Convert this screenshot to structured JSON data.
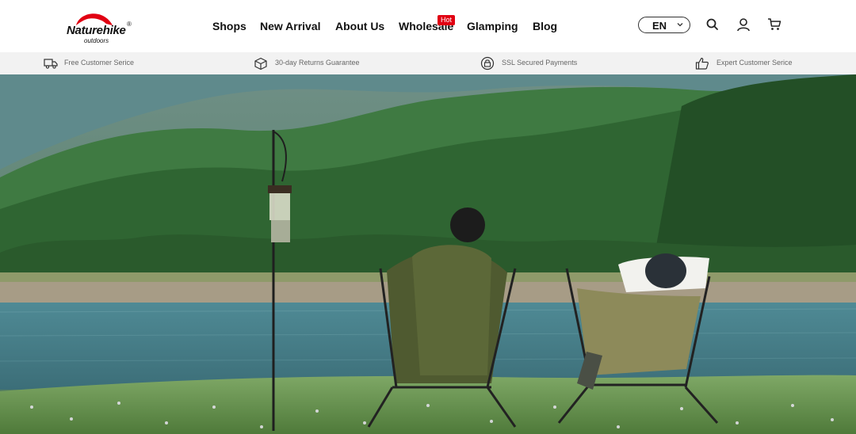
{
  "logo": {
    "main": "Naturehike",
    "sub": "outdoors",
    "reg": "®"
  },
  "nav": {
    "items": [
      "Shops",
      "New Arrival",
      "About Us",
      "Wholesale",
      "Glamping",
      "Blog"
    ],
    "hot_badge": "Hot"
  },
  "header": {
    "lang": "EN",
    "icons": [
      "search-icon",
      "account-icon",
      "cart-icon"
    ]
  },
  "trust": [
    {
      "icon": "truck-icon",
      "text": "Free Customer Serice"
    },
    {
      "icon": "box-icon",
      "text": "30-day Returns Guarantee"
    },
    {
      "icon": "ssl-icon",
      "text": "SSL Secured Payments"
    },
    {
      "icon": "thumbs-up-icon",
      "text": "Expert Customer Serice"
    }
  ],
  "colors": {
    "accent": "#e10012",
    "trustbar_bg": "#f2f2f2",
    "trust_text": "#666666"
  }
}
